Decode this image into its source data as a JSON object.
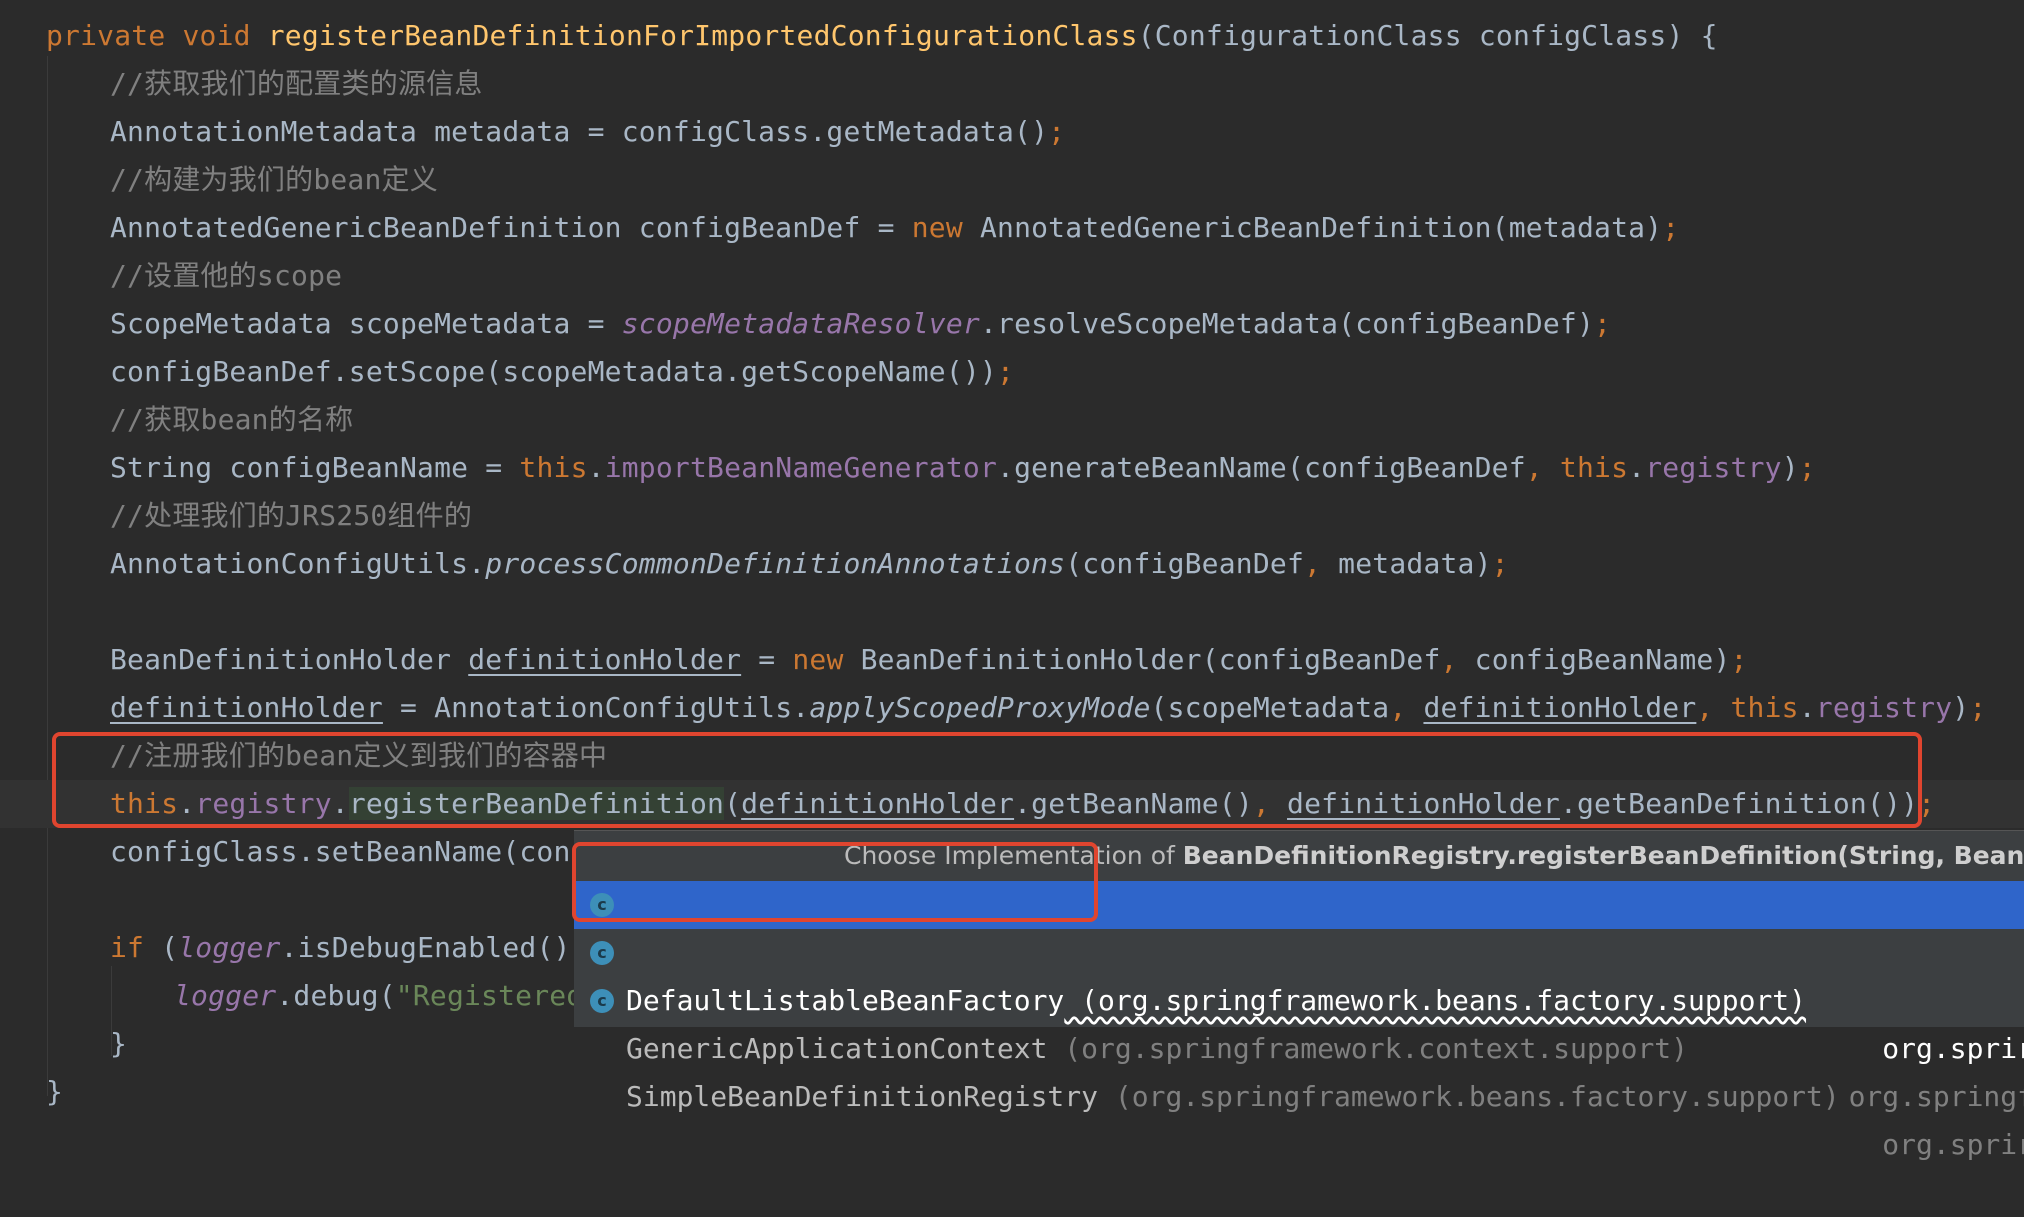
{
  "editor": {
    "lines": {
      "l1": {
        "kw": "private void ",
        "method": "registerBeanDefinitionForImportedConfigurationClass",
        "rest": "(ConfigurationClass configClass) {"
      },
      "l2": {
        "comment": "//获取我们的配置类的源信息"
      },
      "l3": {
        "a": "AnnotationMetadata metadata = configClass.getMetadata()",
        "p": ";"
      },
      "l4": {
        "comment": "//构建为我们的bean定义"
      },
      "l5": {
        "a": "AnnotatedGenericBeanDefinition configBeanDef = ",
        "kw": "new",
        "b": " AnnotatedGenericBeanDefinition(metadata)",
        "p": ";"
      },
      "l6": {
        "comment": "//设置他的scope"
      },
      "l7": {
        "a": "ScopeMetadata scopeMetadata = ",
        "static": "scopeMetadataResolver",
        "b": ".resolveScopeMetadata(configBeanDef)",
        "p": ";"
      },
      "l8": {
        "a": "configBeanDef.setScope(scopeMetadata.getScopeName())",
        "p": ";"
      },
      "l9": {
        "comment": "//获取bean的名称"
      },
      "l10": {
        "a": "String configBeanName = ",
        "kw1": "this",
        "dot1": ".",
        "field1": "importBeanNameGenerator",
        "b": ".generateBeanName(configBeanDef",
        "p1": ",",
        "sp": " ",
        "kw2": "this",
        "dot2": ".",
        "field2": "registry",
        "c": ")",
        "p2": ";"
      },
      "l11": {
        "comment": "//处理我们的JRS250组件的"
      },
      "l12": {
        "a": "AnnotationConfigUtils.",
        "italic": "processCommonDefinitionAnnotations",
        "b": "(configBeanDef",
        "p1": ",",
        "c": " metadata)",
        "p2": ";"
      },
      "l14": {
        "a": "BeanDefinitionHolder ",
        "u1": "definitionHolder",
        "b": " = ",
        "kw": "new",
        "c": " BeanDefinitionHolder(configBeanDef",
        "p1": ",",
        "d": " configBeanName)",
        "p2": ";"
      },
      "l15": {
        "u1": "definitionHolder",
        "a": " = AnnotationConfigUtils.",
        "italic": "applyScopedProxyMode",
        "b": "(scopeMetadata",
        "p1": ",",
        "sp": " ",
        "u2": "definitionHolder",
        "p2": ",",
        "sp2": " ",
        "kw": "this",
        "dot": ".",
        "field": "registry",
        "c": ")",
        "p3": ";"
      },
      "l16": {
        "comment": "//注册我们的bean定义到我们的容器中"
      },
      "l17": {
        "kw": "this",
        "dot": ".",
        "field": "registry",
        "dot2": ".",
        "hl": "registerBeanDefinition",
        "a": "(",
        "u1": "definitionHolder",
        "b": ".getBeanName()",
        "p1": ",",
        "sp": " ",
        "u2": "definitionHolder",
        "c": ".getBeanDefinition())",
        "p2": ";"
      },
      "l18": {
        "a": "configClass.setBeanName(confi"
      },
      "l20": {
        "kw": "if",
        "a": " (",
        "static": "logger",
        "b": ".isDebugEnabled())"
      },
      "l21": {
        "static": "logger",
        "a": ".debug(",
        "string": "\"Registered"
      },
      "l22": {
        "a": "}"
      },
      "l23": {
        "a": "}"
      }
    }
  },
  "popup": {
    "title_prefix": "Choose Implementation of ",
    "title_bold": "BeanDefinitionRegistry.registerBeanDefinition(String, BeanDefi",
    "items": [
      {
        "icon": "c",
        "name": "DefaultListableBeanFactory",
        "pkg": " (org.springframework.beans.factory.support)",
        "location": "org.sprir"
      },
      {
        "icon": "c",
        "name": "GenericApplicationContext",
        "pkg": " (org.springframework.context.support)",
        "location": "org.springf"
      },
      {
        "icon": "c",
        "name": "SimpleBeanDefinitionRegistry",
        "pkg": " (org.springframework.beans.factory.support)",
        "location": "org.sprir"
      }
    ]
  },
  "colors": {
    "background": "#2b2b2b",
    "keyword": "#cc7832",
    "method": "#ffc66d",
    "field": "#9876aa",
    "comment": "#808080",
    "string": "#6a8759",
    "selection": "#2f65ca",
    "annotation_box": "#e0452f"
  }
}
